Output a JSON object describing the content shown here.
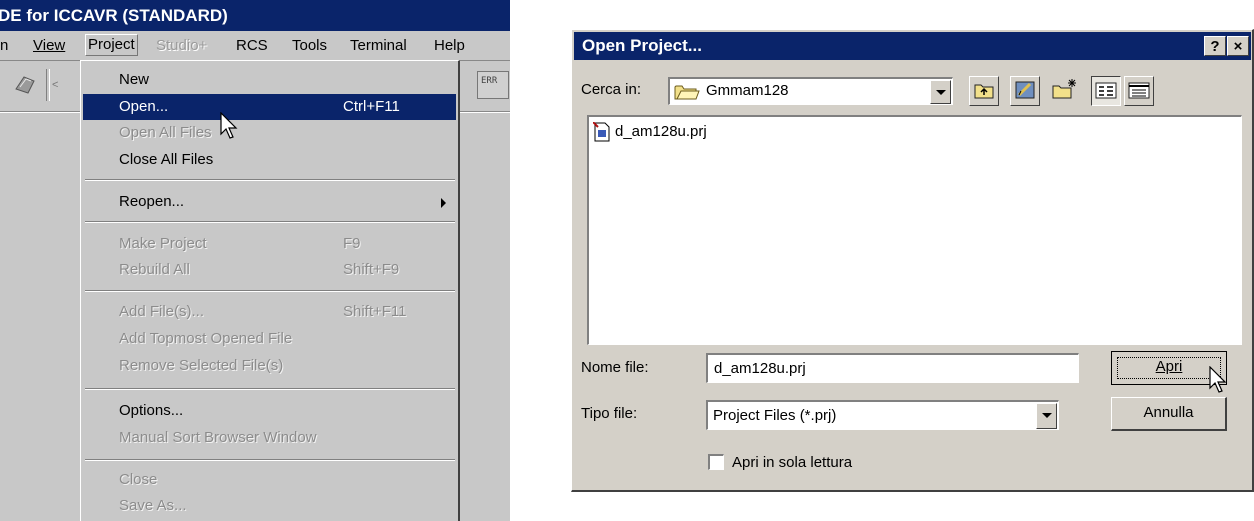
{
  "ide": {
    "title": "DE for ICCAVR (STANDARD)",
    "menubar": [
      {
        "label": "n",
        "disabled": false
      },
      {
        "label": "View",
        "disabled": false
      },
      {
        "label": "Project",
        "disabled": false
      },
      {
        "label": "Studio+",
        "disabled": true
      },
      {
        "label": "RCS",
        "disabled": false
      },
      {
        "label": "Tools",
        "disabled": false
      },
      {
        "label": "Terminal",
        "disabled": false
      },
      {
        "label": "Help",
        "disabled": false
      }
    ],
    "project_menu": {
      "new": "New",
      "open": "Open...",
      "open_shortcut": "Ctrl+F11",
      "open_all_files": "Open All Files",
      "close_all_files": "Close All Files",
      "reopen": "Reopen...",
      "make_project": "Make Project",
      "make_project_shortcut": "F9",
      "rebuild_all": "Rebuild All",
      "rebuild_all_shortcut": "Shift+F9",
      "add_files": "Add File(s)...",
      "add_files_shortcut": "Shift+F11",
      "add_topmost": "Add Topmost Opened File",
      "remove_selected": "Remove Selected File(s)",
      "options": "Options...",
      "manual_sort": "Manual Sort Browser Window",
      "close": "Close",
      "save_as": "Save As..."
    }
  },
  "dialog": {
    "title": "Open Project...",
    "help_btn": "?",
    "close_btn": "×",
    "look_in_label": "Cerca in:",
    "look_in_value": "Gmmam128",
    "files": [
      "d_am128u.prj"
    ],
    "file_name_label": "Nome file:",
    "file_name_value": "d_am128u.prj",
    "file_type_label": "Tipo file:",
    "file_type_value": "Project Files (*.prj)",
    "open_button": "Apri",
    "cancel_button": "Annulla",
    "readonly_label": "Apri in sola lettura",
    "readonly_checked": false
  },
  "colors": {
    "title_bar": "#0a246a",
    "face": "#d4d0c8",
    "ide_face": "#c8c8c8",
    "disabled_text": "#8c8c8c"
  }
}
